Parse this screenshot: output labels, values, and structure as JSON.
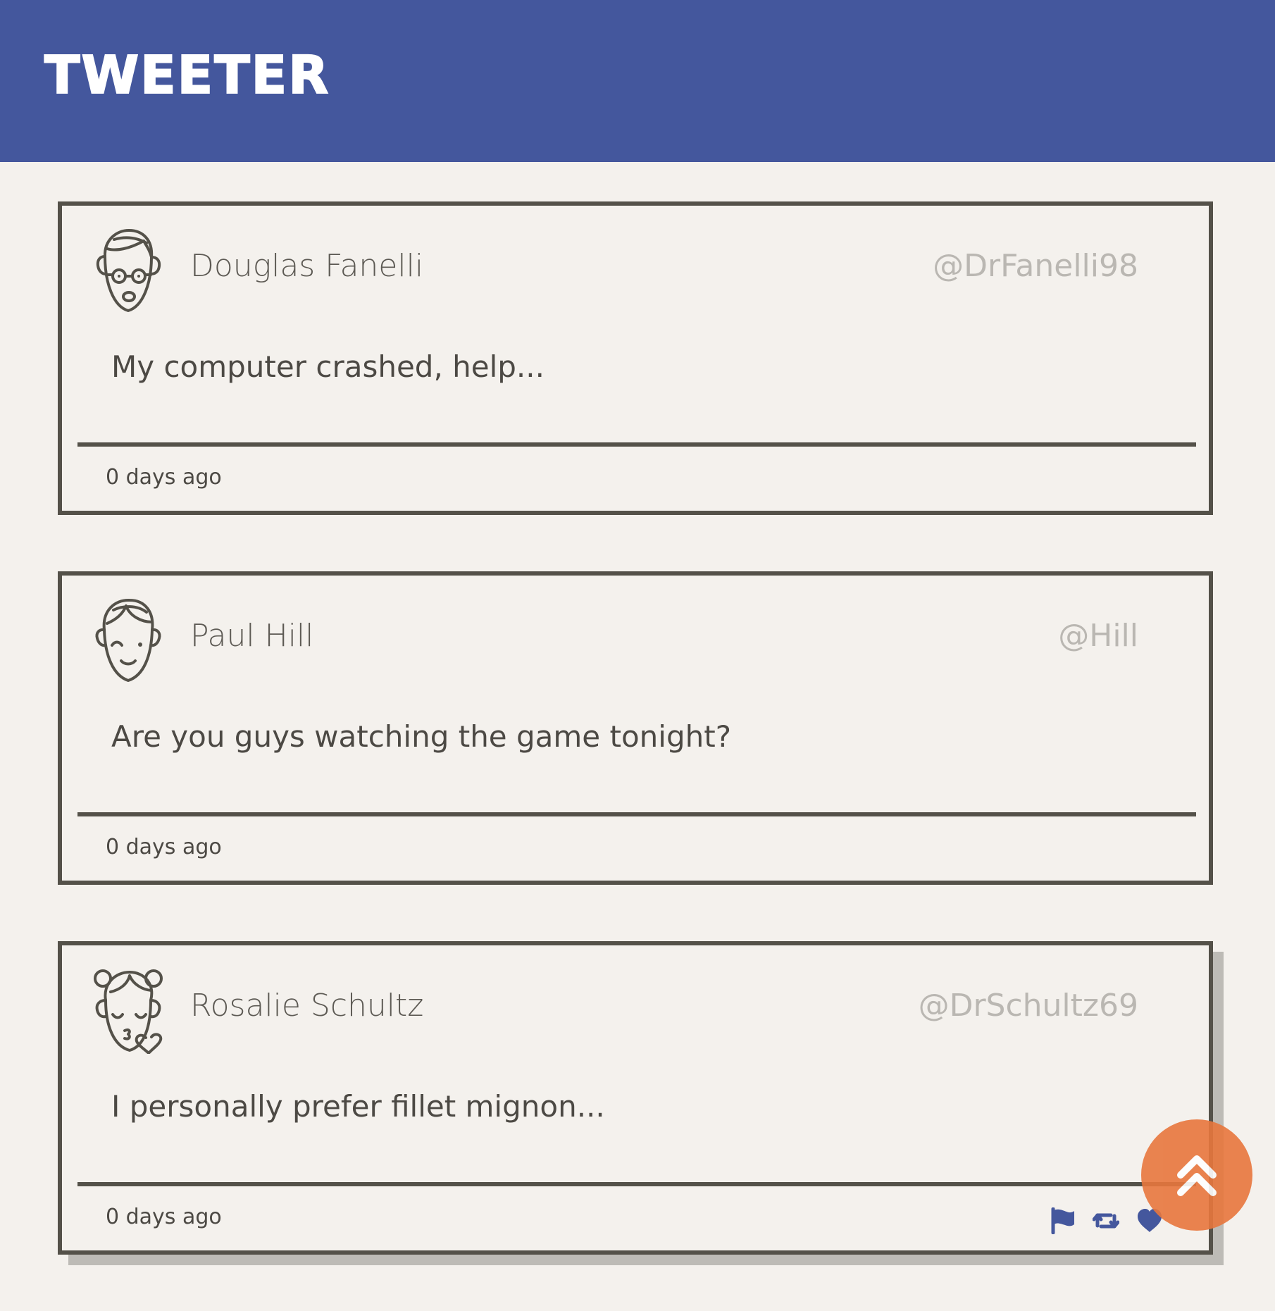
{
  "app": {
    "title": "TWEETER"
  },
  "theme": {
    "header_bg": "#44579d",
    "page_bg": "#f4f1ed",
    "card_border": "#545149",
    "action_icon_color": "#44579d",
    "scroll_button_bg": "#e8773d"
  },
  "tweets": [
    {
      "name": "Douglas Fanelli",
      "handle": "@DrFanelli98",
      "content": "My computer crashed, help...",
      "time": "0 days ago",
      "avatar_icon": "man-with-glasses-avatar-icon"
    },
    {
      "name": "Paul Hill",
      "handle": "@Hill",
      "content": "Are you guys watching the game tonight?",
      "time": "0 days ago",
      "avatar_icon": "winking-boy-avatar-icon"
    },
    {
      "name": "Rosalie Schultz",
      "handle": "@DrSchultz69",
      "content": "I personally prefer fillet mignon...",
      "time": "0 days ago",
      "avatar_icon": "girl-blowing-kiss-avatar-icon",
      "actions": [
        "flag-icon",
        "retweet-icon",
        "heart-icon"
      ]
    }
  ],
  "scroll_top_button": {
    "icon": "double-chevron-up-icon"
  }
}
